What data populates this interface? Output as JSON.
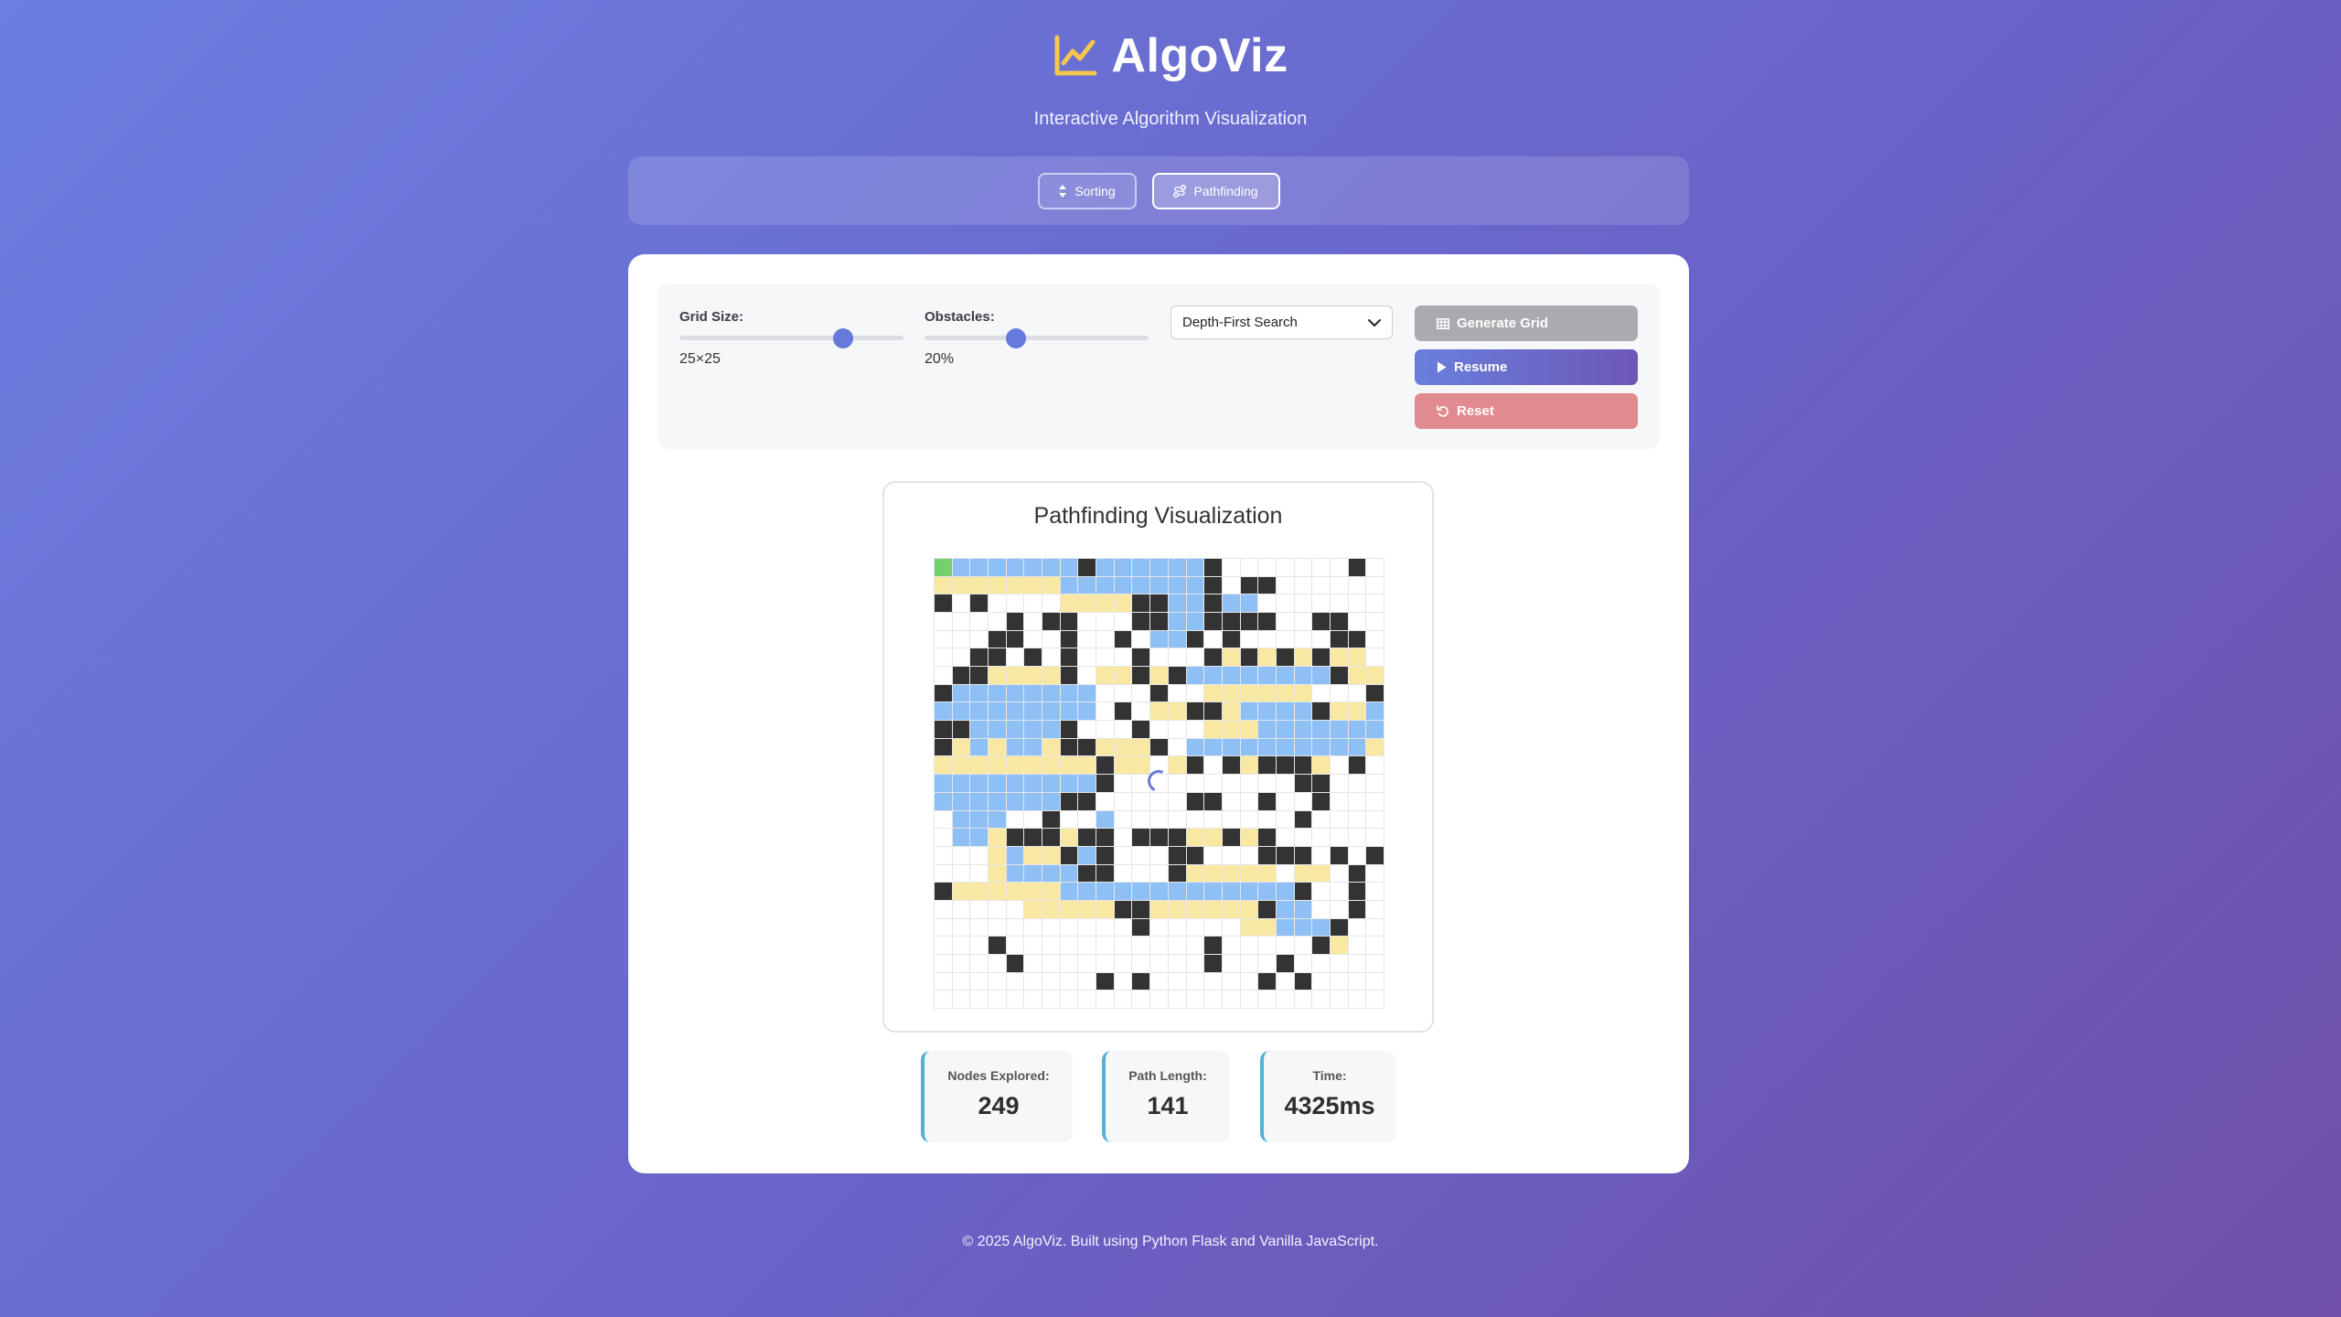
{
  "app": {
    "title": "AlgoViz",
    "subtitle": "Interactive Algorithm Visualization",
    "logo_icon": "chart-line-icon"
  },
  "tabs": [
    {
      "label": "Sorting",
      "icon": "sort-icon",
      "active": false
    },
    {
      "label": "Pathfinding",
      "icon": "route-icon",
      "active": true
    }
  ],
  "controls": {
    "grid_size": {
      "label": "Grid Size:",
      "value": "25×25",
      "level": 0.73
    },
    "obstacles": {
      "label": "Obstacles:",
      "value": "20%",
      "level": 0.41
    },
    "algorithm": {
      "selected": "Depth-First Search"
    },
    "buttons": {
      "generate": "Generate Grid",
      "resume": "Resume",
      "reset": "Reset"
    }
  },
  "visualization": {
    "title": "Pathfinding Visualization",
    "grid": [
      "SVVVVVVVWVVVVVVWO...O..W.",
      "PPPPPPPVVVVVVVVWOWW......",
      "W.W....PPPPWWVVWVV.......",
      "....W.WW...WWVVWWWW..WW..",
      "...WW..W..W.VVW.W..O..WW.",
      "..WW.W.W...W...WPWPWPWPP.",
      ".WWPPPPW.PPWPWVVVVVVVVWPP",
      "WVVVVVVVV...W..PPPPPP...W",
      "VVVVVVVVV.W.PPWWPVVVVWPPV",
      "WWVVVVVW...W...PPPVVVVVVV",
      "WPVPVVPWWPPPW.VVVVVVVVVVP",
      "PPPPPPPPPWPP.PW.WPWWWP.W.",
      "VVVVVVVVVW..........WW...",
      "VVVVVVVWW.....WW..W..W...",
      ".VVV..W..V..........W....",
      ".VVPWWWPWW.WWWPPWPW......",
      "...PVPPWVW...WW...WWW.W.W",
      "...PVVVVWW...WPPPPP.PP.W.",
      "WPPPPPPVVVVVVVVVVVVVW..W.",
      ".....PPPPPWWPPPPPPWVV..W.",
      "...........W.....PPVVVW..",
      "...W...........W.....WP..",
      "....W..........W...W.....",
      ".........W.W......W.W....",
      ".........................E"
    ]
  },
  "stats": [
    {
      "label": "Nodes Explored:",
      "value": "249"
    },
    {
      "label": "Path Length:",
      "value": "141"
    },
    {
      "label": "Time:",
      "value": "4325ms"
    }
  ],
  "footer": "© 2025 AlgoViz. Built using Python Flask and Vanilla JavaScript.",
  "colors": {
    "wall": "#333333",
    "visited": "#8ec0f6",
    "path": "#f9e8a2",
    "start": "#74cf6e",
    "end": "#ea6f6c",
    "accent": "#6679dc"
  }
}
